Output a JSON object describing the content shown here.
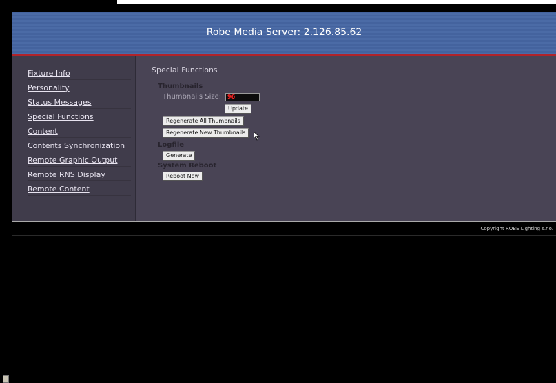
{
  "header": {
    "title": "Robe Media Server: 2.126.85.62"
  },
  "sidebar": {
    "items": [
      {
        "label": "Fixture Info"
      },
      {
        "label": "Personality"
      },
      {
        "label": "Status Messages"
      },
      {
        "label": "Special Functions"
      },
      {
        "label": "Content"
      },
      {
        "label": "Contents Synchronization"
      },
      {
        "label": "Remote Graphic Output"
      },
      {
        "label": "Remote RNS Display"
      },
      {
        "label": "Remote Content"
      }
    ]
  },
  "main": {
    "section_title": "Special Functions",
    "thumbnails": {
      "heading": "Thumbnails",
      "size_label": "Thumbnails Size:",
      "size_value": "96",
      "update_label": "Update",
      "regen_all_label": "Regenerate All Thumbnails",
      "regen_new_label": "Regenerate New Thumbnails"
    },
    "logfile": {
      "heading": "Logfile",
      "generate_label": "Generate"
    },
    "reboot": {
      "heading": "System Reboot",
      "reboot_label": "Reboot Now"
    }
  },
  "footer": {
    "copyright": "Copyright ROBE Lighting s.r.o."
  },
  "colors": {
    "header_bg": "#4b6ba6",
    "accent_rule": "#b1232a",
    "panel_bg": "#494455",
    "sidebar_bg": "#403c4b"
  }
}
